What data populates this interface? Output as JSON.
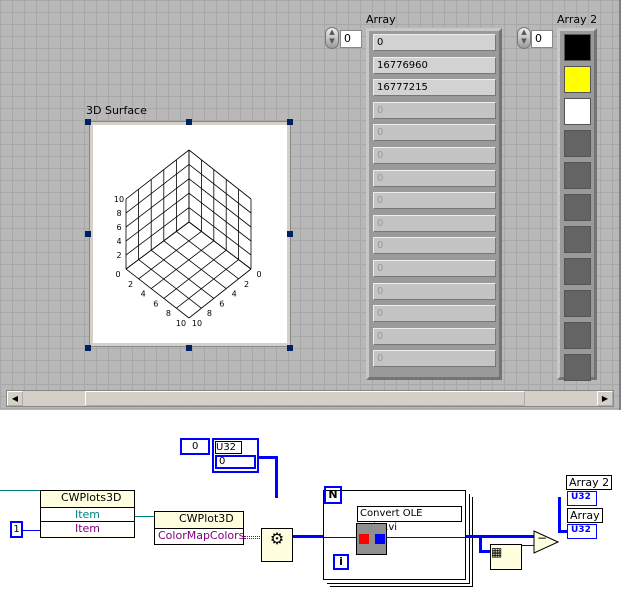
{
  "front_panel": {
    "surface": {
      "label": "3D Surface",
      "vertical_ticks": [
        "2",
        "4",
        "6",
        "8",
        "10"
      ],
      "floor_ticks_left": [
        "0",
        "2",
        "4",
        "6",
        "8",
        "10"
      ],
      "floor_ticks_right": [
        "0",
        "2",
        "4",
        "6",
        "8",
        "10"
      ]
    },
    "array": {
      "label": "Array",
      "index": "0",
      "values": [
        "0",
        "16776960",
        "16777215",
        "0",
        "0",
        "0",
        "0",
        "0",
        "0",
        "0",
        "0",
        "0",
        "0",
        "0",
        "0"
      ]
    },
    "array2": {
      "label": "Array 2",
      "index": "0",
      "colors": [
        "#000000",
        "#ffff00",
        "#ffffff",
        "#646464",
        "#646464",
        "#646464",
        "#646464",
        "#646464",
        "#646464",
        "#646464",
        "#646464"
      ]
    }
  },
  "block_diagram": {
    "index_const": "0",
    "u32_label": "U32",
    "u32_value": "0",
    "item_const": "1",
    "plots_node": {
      "title": "CWPlots3D",
      "rows": [
        "Item",
        "Item"
      ]
    },
    "plot_node": {
      "title": "CWPlot3D",
      "rows": [
        "ColorMapColors"
      ]
    },
    "loop_count": "N",
    "loop_index": "i",
    "subvi_label": "Convert OLE Color.vi",
    "ind_array2": {
      "label": "Array 2",
      "type": "U32"
    },
    "ind_array": {
      "label": "Array",
      "type": "U32"
    },
    "subtract_symbol": "−"
  }
}
